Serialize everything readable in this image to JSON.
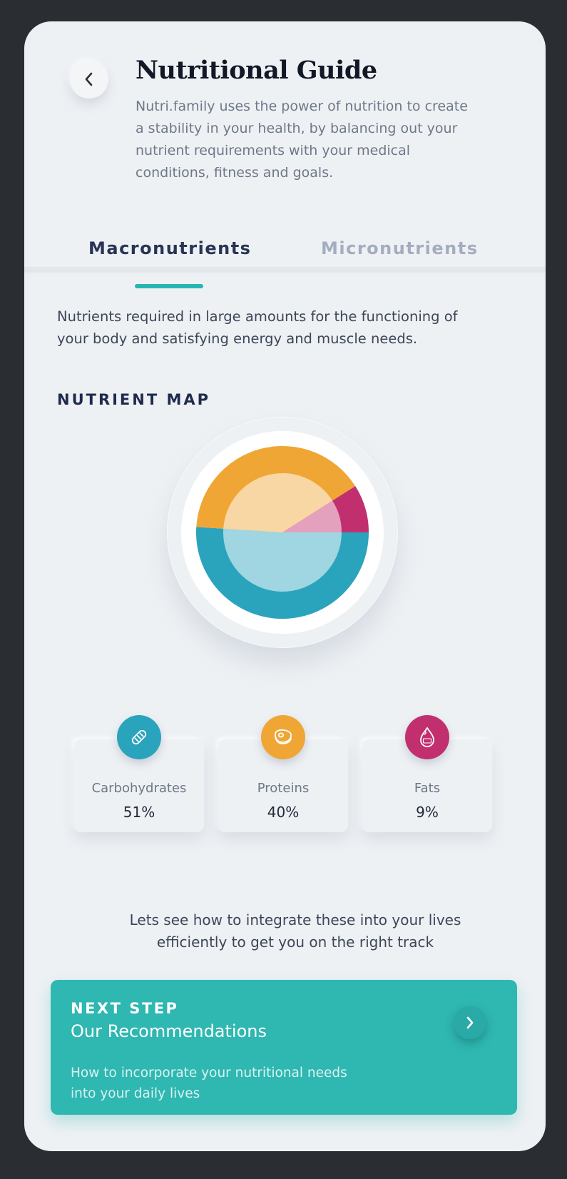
{
  "header": {
    "title": "Nutritional Guide",
    "intro": "Nutri.family uses the power of nutrition to create a stability in your health, by balancing out your nutrient requirements with your medical conditions, fitness and goals."
  },
  "tabs": [
    {
      "label": "Macronutrients",
      "active": true
    },
    {
      "label": "Micronutrients",
      "active": false
    }
  ],
  "description": "Nutrients required in large amounts for the functioning of your body and satisfying energy and muscle needs.",
  "nutrient_map": {
    "title": "NUTRIENT MAP"
  },
  "chart_data": {
    "type": "pie",
    "categories": [
      "Carbohydrates",
      "Proteins",
      "Fats"
    ],
    "values": [
      51,
      40,
      9
    ],
    "colors": [
      "#2aa4bc",
      "#efa635",
      "#c22f6e"
    ]
  },
  "macros": [
    {
      "name": "Carbohydrates",
      "value": "51%",
      "icon": "bread-icon",
      "color": "#2aa4bc"
    },
    {
      "name": "Proteins",
      "value": "40%",
      "icon": "steak-icon",
      "color": "#efa635"
    },
    {
      "name": "Fats",
      "value": "9%",
      "icon": "fat-drop-icon",
      "color": "#c22f6e"
    }
  ],
  "cta_text": "Lets see how to integrate these into your lives efficiently to get you on the right track",
  "next_step": {
    "kicker": "NEXT STEP",
    "title": "Our Recommendations",
    "subtitle": "How to incorporate your nutritional needs into your daily lives"
  },
  "colors": {
    "accent": "#2fb7b1",
    "background": "#eef1f4",
    "title": "#121826"
  }
}
